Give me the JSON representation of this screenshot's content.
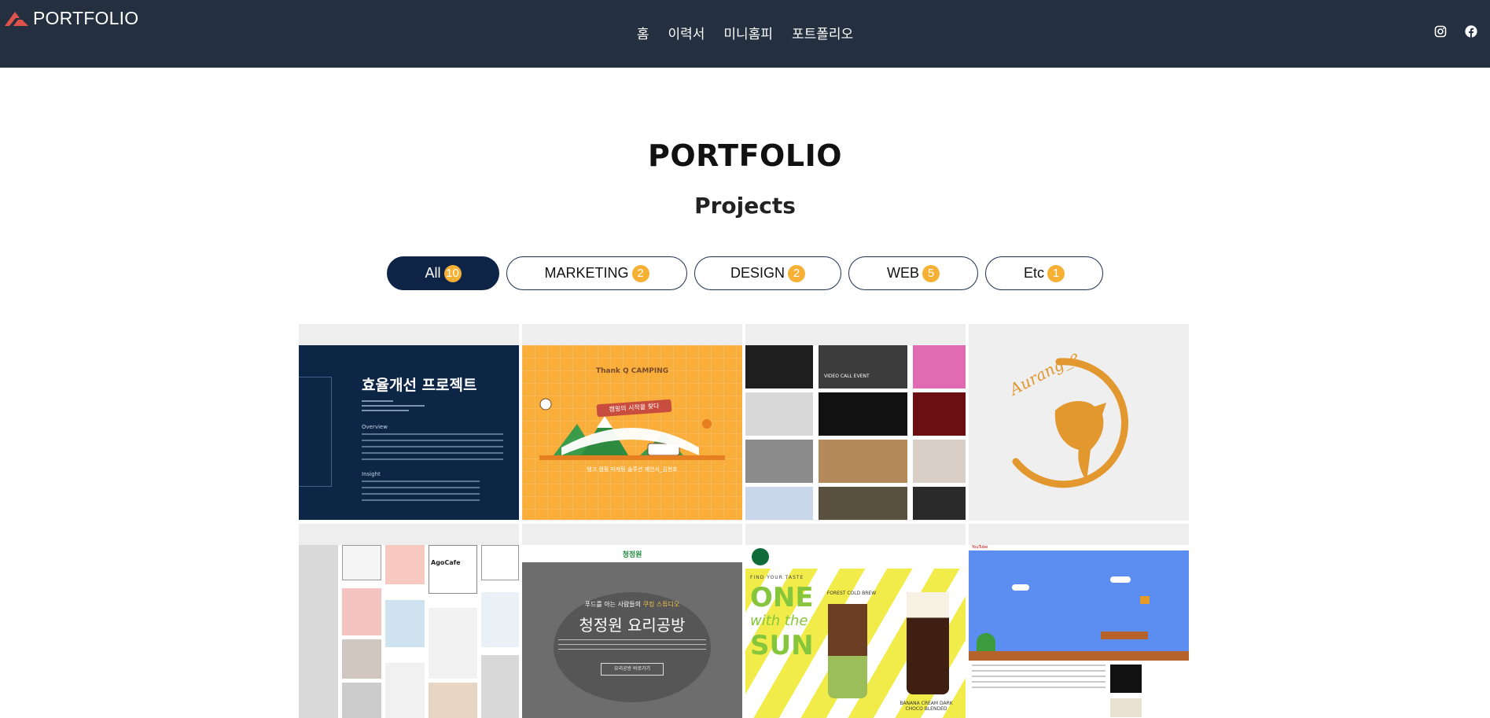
{
  "header": {
    "logo_text": "PORTFOLIO",
    "nav": [
      "홈",
      "이력서",
      "미니홈피",
      "포트폴리오"
    ],
    "social": [
      "instagram-icon",
      "facebook-icon"
    ]
  },
  "page": {
    "title": "PORTFOLIO",
    "subtitle": "Projects"
  },
  "filters": [
    {
      "label": "All",
      "count": "10",
      "active": true
    },
    {
      "label": "MARKETING",
      "count": "2",
      "active": false
    },
    {
      "label": "DESIGN",
      "count": "2",
      "active": false
    },
    {
      "label": "WEB",
      "count": "5",
      "active": false
    },
    {
      "label": "Etc",
      "count": "1",
      "active": false
    }
  ],
  "projects": [
    {
      "heading": "효율개선 프로젝트",
      "sub": [
        "Overview",
        "Insight"
      ]
    },
    {
      "heading": "Thank Q CAMPING",
      "banner": "캠핑의 시작을 찾다",
      "caption": "탱크 캠핑 마케팅 솔루션 제안서_김현호"
    },
    {
      "heading": "VIDEO CALL EVENT"
    },
    {
      "heading": "Aurang_e"
    },
    {
      "heading": "AgoCafe"
    },
    {
      "brand": "청정원",
      "tagline_prefix": "푸드를 아는 사람들의",
      "tagline_highlight": "쿠킹 스튜디오",
      "heading": "청정원 요리공방",
      "button": "요리공방 바로가기"
    },
    {
      "tagline": "FIND YOUR TASTE",
      "heading_lines": [
        "ONE",
        "with the",
        "SUN"
      ],
      "product_1": "FOREST COLD BREW",
      "product_2": "BANANA CREAM DARK CHOCO BLENDED"
    },
    {
      "site": "YouTube"
    }
  ],
  "colors": {
    "header_bg": "#243040",
    "accent_navy": "#0d2447",
    "badge_orange": "#f6b033"
  }
}
